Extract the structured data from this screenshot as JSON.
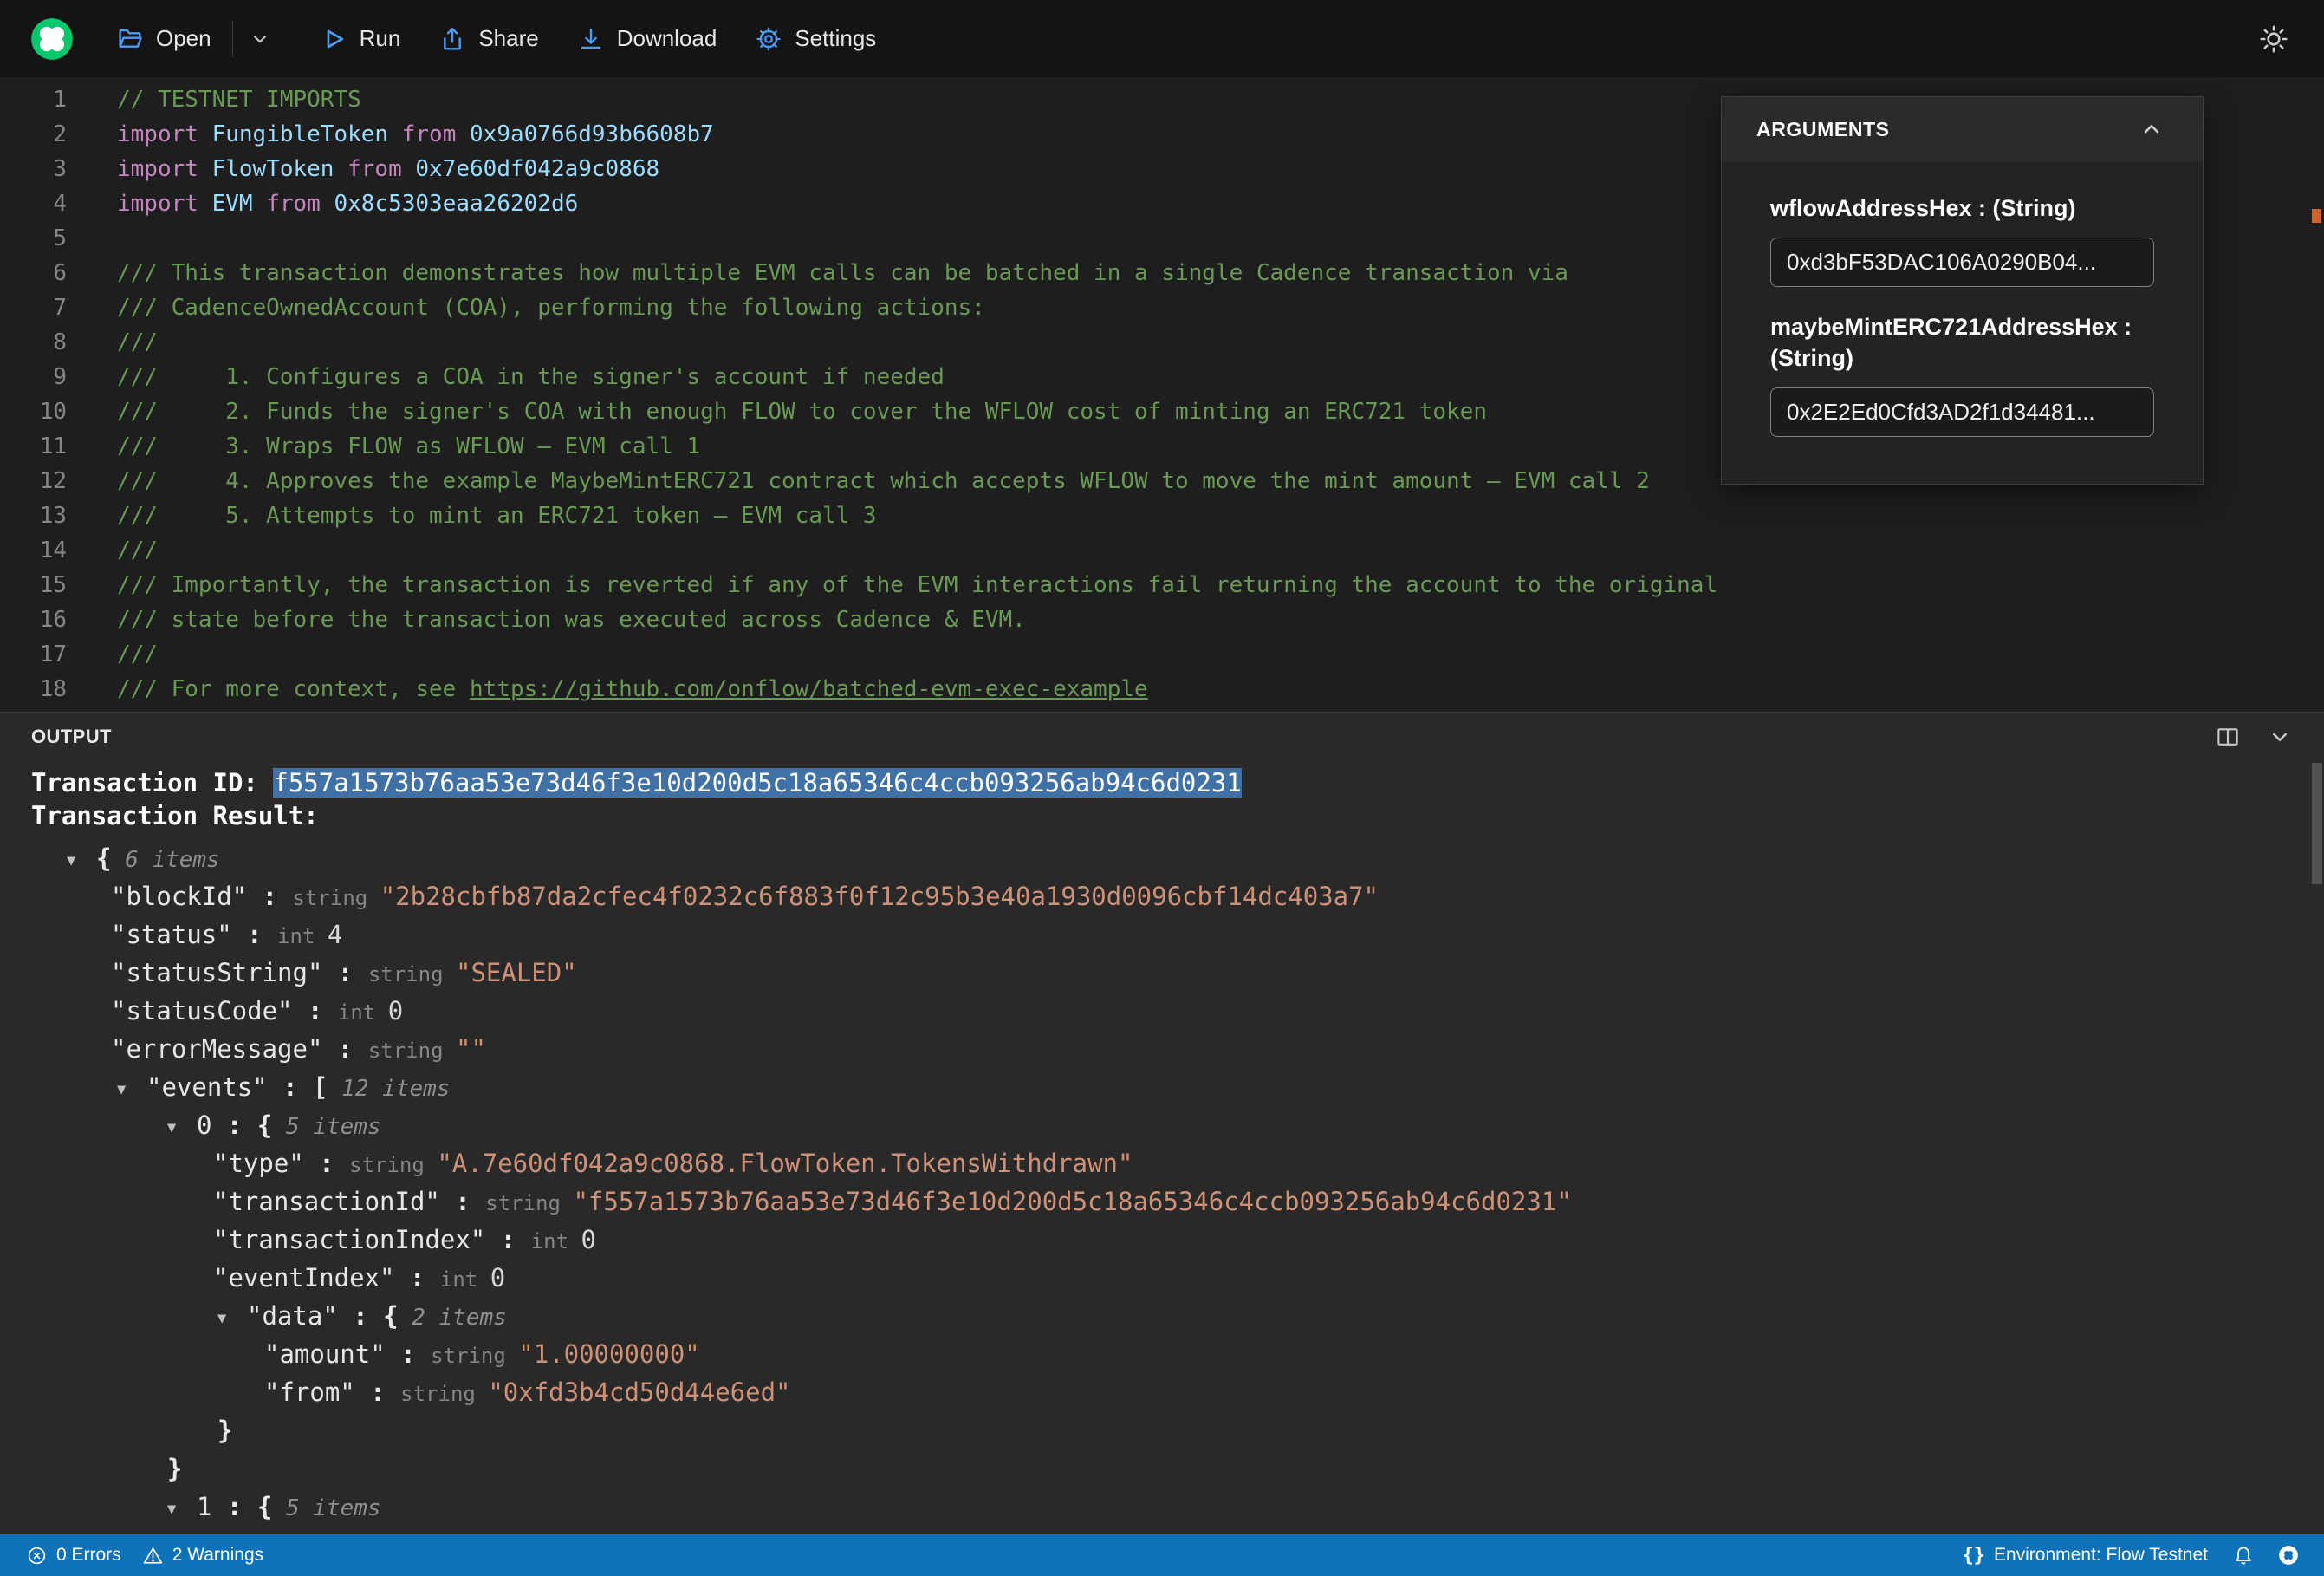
{
  "colors": {
    "flow_green": "#02C76B",
    "statusbar_blue": "#0E72B8",
    "selection_blue": "#3F70A6",
    "accent_blue": "#4A9DF5",
    "comment_green": "#6A9955",
    "string_orange": "#CE9178"
  },
  "toolbar": {
    "open": "Open",
    "run": "Run",
    "share": "Share",
    "download": "Download",
    "settings": "Settings"
  },
  "editor": {
    "lines": [
      {
        "n": "1",
        "seg": [
          [
            "c",
            "// TESTNET IMPORTS"
          ]
        ]
      },
      {
        "n": "2",
        "seg": [
          [
            "k",
            "import "
          ],
          [
            "t",
            "FungibleToken "
          ],
          [
            "k",
            "from "
          ],
          [
            "a",
            "0x9a0766d93b6608b7"
          ]
        ]
      },
      {
        "n": "3",
        "seg": [
          [
            "k",
            "import "
          ],
          [
            "t",
            "FlowToken "
          ],
          [
            "k",
            "from "
          ],
          [
            "a",
            "0x7e60df042a9c0868"
          ]
        ]
      },
      {
        "n": "4",
        "seg": [
          [
            "k",
            "import "
          ],
          [
            "t",
            "EVM "
          ],
          [
            "k",
            "from "
          ],
          [
            "a",
            "0x8c5303eaa26202d6"
          ]
        ]
      },
      {
        "n": "5",
        "seg": []
      },
      {
        "n": "6",
        "seg": [
          [
            "c",
            "/// This transaction demonstrates how multiple EVM calls can be batched in a single Cadence transaction via"
          ]
        ]
      },
      {
        "n": "7",
        "seg": [
          [
            "c",
            "/// CadenceOwnedAccount (COA), performing the following actions:"
          ]
        ]
      },
      {
        "n": "8",
        "seg": [
          [
            "c",
            "///"
          ]
        ]
      },
      {
        "n": "9",
        "seg": [
          [
            "c",
            "///     1. Configures a COA in the signer's account if needed"
          ]
        ]
      },
      {
        "n": "10",
        "seg": [
          [
            "c",
            "///     2. Funds the signer's COA with enough FLOW to cover the WFLOW cost of minting an ERC721 token"
          ]
        ]
      },
      {
        "n": "11",
        "seg": [
          [
            "c",
            "///     3. Wraps FLOW as WFLOW — EVM call 1"
          ]
        ]
      },
      {
        "n": "12",
        "seg": [
          [
            "c",
            "///     4. Approves the example MaybeMintERC721 contract which accepts WFLOW to move the mint amount — EVM call 2"
          ]
        ]
      },
      {
        "n": "13",
        "seg": [
          [
            "c",
            "///     5. Attempts to mint an ERC721 token — EVM call 3"
          ]
        ]
      },
      {
        "n": "14",
        "seg": [
          [
            "c",
            "///"
          ]
        ]
      },
      {
        "n": "15",
        "seg": [
          [
            "c",
            "/// Importantly, the transaction is reverted if any of the EVM interactions fail returning the account to the original"
          ]
        ]
      },
      {
        "n": "16",
        "seg": [
          [
            "c",
            "/// state before the transaction was executed across Cadence & EVM."
          ]
        ]
      },
      {
        "n": "17",
        "seg": [
          [
            "c",
            "///"
          ]
        ]
      },
      {
        "n": "18",
        "seg": [
          [
            "c",
            "/// For more context, see "
          ],
          [
            "l",
            "https://github.com/onflow/batched-evm-exec-example"
          ]
        ]
      }
    ]
  },
  "arguments_panel": {
    "title": "ARGUMENTS",
    "fields": [
      {
        "label": "wflowAddressHex : (String)",
        "value": "0xd3bF53DAC106A0290B04..."
      },
      {
        "label": "maybeMintERC721AddressHex : (String)",
        "value": "0x2E2Ed0Cfd3AD2f1d34481..."
      }
    ]
  },
  "output": {
    "title": "OUTPUT",
    "tx_id_label": "Transaction ID: ",
    "tx_id": "f557a1573b76aa53e73d46f3e10d200d5c18a65346c4ccb093256ab94c6d0231",
    "tx_result_label": "Transaction Result:",
    "tree": [
      {
        "d": 0,
        "a": true,
        "seg": [
          [
            "pun",
            "{"
          ],
          [
            "itm",
            " 6 items"
          ]
        ]
      },
      {
        "d": 1,
        "seg": [
          [
            "key",
            "\"blockId\""
          ],
          [
            "pun",
            " : "
          ],
          [
            "typ",
            "string "
          ],
          [
            "str",
            "\"2b28cbfb87da2cfec4f0232c6f883f0f12c95b3e40a1930d0096cbf14dc403a7\""
          ]
        ]
      },
      {
        "d": 1,
        "seg": [
          [
            "key",
            "\"status\""
          ],
          [
            "pun",
            " : "
          ],
          [
            "typ",
            "int "
          ],
          [
            "int",
            "4"
          ]
        ]
      },
      {
        "d": 1,
        "seg": [
          [
            "key",
            "\"statusString\""
          ],
          [
            "pun",
            " : "
          ],
          [
            "typ",
            "string "
          ],
          [
            "str",
            "\"SEALED\""
          ]
        ]
      },
      {
        "d": 1,
        "seg": [
          [
            "key",
            "\"statusCode\""
          ],
          [
            "pun",
            " : "
          ],
          [
            "typ",
            "int "
          ],
          [
            "int",
            "0"
          ]
        ]
      },
      {
        "d": 1,
        "seg": [
          [
            "key",
            "\"errorMessage\""
          ],
          [
            "pun",
            " : "
          ],
          [
            "typ",
            "string "
          ],
          [
            "str",
            "\"\""
          ]
        ]
      },
      {
        "d": 1,
        "a": true,
        "seg": [
          [
            "key",
            "\"events\""
          ],
          [
            "pun",
            " : ["
          ],
          [
            "itm",
            " 12 items"
          ]
        ]
      },
      {
        "d": 2,
        "a": true,
        "seg": [
          [
            "idx",
            "0"
          ],
          [
            "pun",
            " : {"
          ],
          [
            "itm",
            " 5 items"
          ]
        ]
      },
      {
        "d": 3,
        "seg": [
          [
            "key",
            "\"type\""
          ],
          [
            "pun",
            " : "
          ],
          [
            "typ",
            "string "
          ],
          [
            "str",
            "\"A.7e60df042a9c0868.FlowToken.TokensWithdrawn\""
          ]
        ]
      },
      {
        "d": 3,
        "seg": [
          [
            "key",
            "\"transactionId\""
          ],
          [
            "pun",
            " : "
          ],
          [
            "typ",
            "string "
          ],
          [
            "str",
            "\"f557a1573b76aa53e73d46f3e10d200d5c18a65346c4ccb093256ab94c6d0231\""
          ]
        ]
      },
      {
        "d": 3,
        "seg": [
          [
            "key",
            "\"transactionIndex\""
          ],
          [
            "pun",
            " : "
          ],
          [
            "typ",
            "int "
          ],
          [
            "int",
            "0"
          ]
        ]
      },
      {
        "d": 3,
        "seg": [
          [
            "key",
            "\"eventIndex\""
          ],
          [
            "pun",
            " : "
          ],
          [
            "typ",
            "int "
          ],
          [
            "int",
            "0"
          ]
        ]
      },
      {
        "d": 3,
        "a": true,
        "seg": [
          [
            "key",
            "\"data\""
          ],
          [
            "pun",
            " : {"
          ],
          [
            "itm",
            " 2 items"
          ]
        ]
      },
      {
        "d": 4,
        "seg": [
          [
            "key",
            "\"amount\""
          ],
          [
            "pun",
            " : "
          ],
          [
            "typ",
            "string "
          ],
          [
            "str",
            "\"1.00000000\""
          ]
        ]
      },
      {
        "d": 4,
        "seg": [
          [
            "key",
            "\"from\""
          ],
          [
            "pun",
            " : "
          ],
          [
            "typ",
            "string "
          ],
          [
            "str",
            "\"0xfd3b4cd50d44e6ed\""
          ]
        ]
      },
      {
        "d": 3,
        "close": true,
        "seg": [
          [
            "pun",
            "}"
          ]
        ]
      },
      {
        "d": 2,
        "close": true,
        "seg": [
          [
            "pun",
            "}"
          ]
        ]
      },
      {
        "d": 2,
        "a": true,
        "seg": [
          [
            "idx",
            "1"
          ],
          [
            "pun",
            " : {"
          ],
          [
            "itm",
            " 5 items"
          ]
        ]
      }
    ]
  },
  "statusbar": {
    "errors": "0 Errors",
    "warnings": "2 Warnings",
    "braces": "{}",
    "environment": "Environment: Flow Testnet"
  }
}
